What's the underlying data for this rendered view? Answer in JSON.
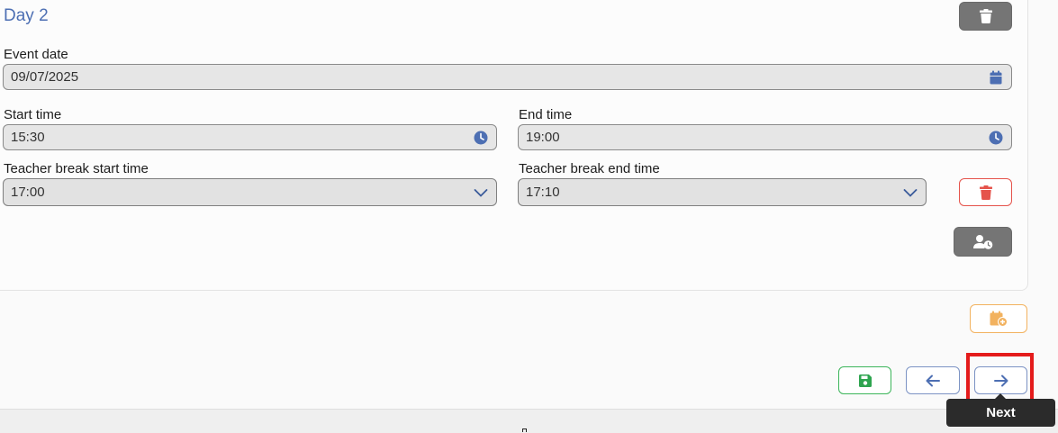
{
  "day": {
    "title": "Day 2"
  },
  "event_date": {
    "label": "Event date",
    "value": "09/07/2025"
  },
  "start_time": {
    "label": "Start time",
    "value": "15:30"
  },
  "end_time": {
    "label": "End time",
    "value": "19:00"
  },
  "break_start": {
    "label": "Teacher break start time",
    "value": "17:00"
  },
  "break_end": {
    "label": "Teacher break end time",
    "value": "17:10"
  },
  "tooltip": {
    "text": "Next"
  },
  "icons": {
    "day_delete": "trash-icon",
    "calendar": "calendar-icon",
    "clock": "clock-icon",
    "chevron": "chevron-down-icon",
    "break_delete": "trash-icon",
    "assign_teacher": "user-clock-icon",
    "add_day": "calendar-plus-icon",
    "save": "floppy-disk-icon",
    "back": "arrow-left-icon",
    "next": "arrow-right-icon"
  },
  "colors": {
    "title": "#4d6fb3",
    "icon_blue": "#4d6fb3",
    "delete_red": "#e5534b",
    "add_orange": "#f2b25f",
    "save_green": "#3cb55a",
    "gray_button": "#757575",
    "highlight": "#e41b1b"
  }
}
